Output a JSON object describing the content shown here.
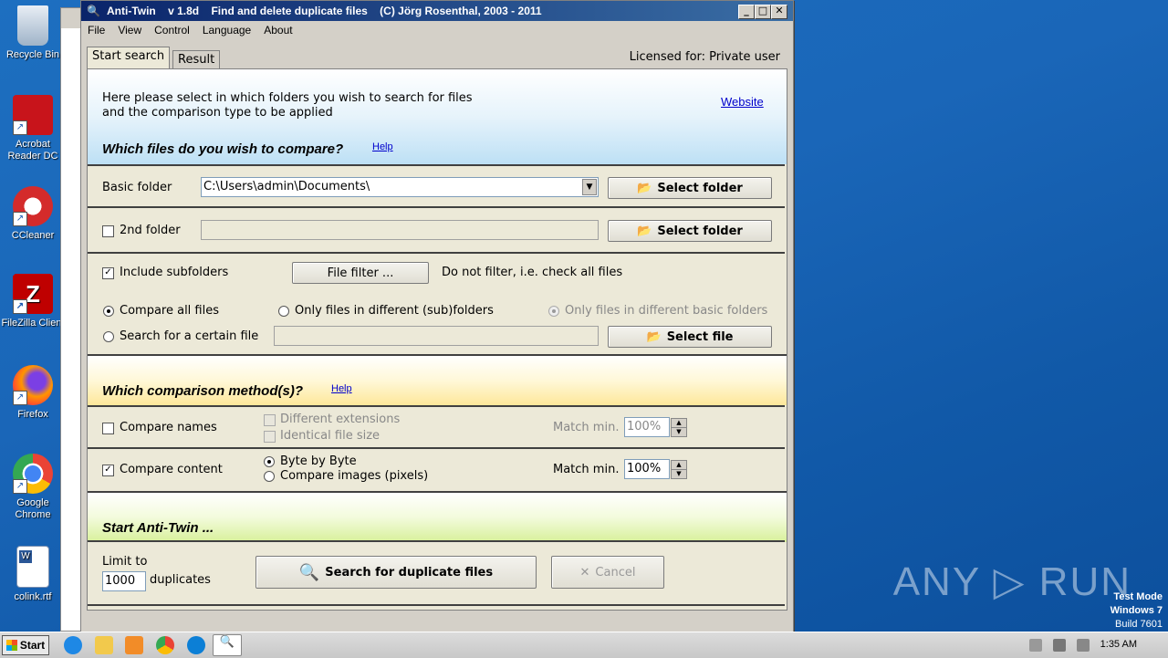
{
  "desktop": {
    "icons": [
      {
        "label": "Recycle Bin",
        "icon": "recycle-bin-icon"
      },
      {
        "label": "Acrobat Reader DC",
        "icon": "acrobat-icon"
      },
      {
        "label": "CCleaner",
        "icon": "ccleaner-icon"
      },
      {
        "label": "FileZilla Client",
        "icon": "filezilla-icon"
      },
      {
        "label": "Firefox",
        "icon": "firefox-icon"
      },
      {
        "label": "Google Chrome",
        "icon": "chrome-icon"
      },
      {
        "label": "colink.rtf",
        "icon": "word-doc-icon"
      }
    ],
    "watermark": "ANY ▷ RUN",
    "test_mode": {
      "line1": "Test Mode",
      "line2": "Windows 7",
      "line3": "Build 7601"
    }
  },
  "window": {
    "title": "Anti-Twin    v 1.8d    Find and delete duplicate files    (C) Jörg Rosenthal, 2003 - 2011",
    "menu": [
      "File",
      "View",
      "Control",
      "Language",
      "About"
    ],
    "tabs": [
      "Start search",
      "Result"
    ],
    "licensed": "Licensed for: Private user"
  },
  "intro": {
    "line1": "Here please select in which folders you wish to search for files",
    "line2": "and the comparison type to be applied",
    "website": "Website"
  },
  "files_section": {
    "title": "Which files do you wish to compare?",
    "help": "Help",
    "basic_folder_label": "Basic folder",
    "basic_folder_value": "C:\\Users\\admin\\Documents\\",
    "select_folder": "Select folder",
    "second_folder_label": "2nd folder",
    "include_subfolders": "Include subfolders",
    "file_filter": "File filter ...",
    "filter_status": "Do not filter, i.e. check all files",
    "compare_all": "Compare all files",
    "only_diff_sub": "Only files in different (sub)folders",
    "only_diff_basic": "Only files in different basic folders",
    "search_certain": "Search for a certain file",
    "select_file": "Select file"
  },
  "method_section": {
    "title": "Which comparison method(s)?",
    "help": "Help",
    "compare_names": "Compare names",
    "diff_ext": "Different extensions",
    "identical_size": "Identical file size",
    "match_min": "Match min.",
    "names_match_value": "100%",
    "compare_content": "Compare content",
    "byte_by_byte": "Byte by Byte",
    "compare_images": "Compare images (pixels)",
    "content_match_value": "100%"
  },
  "start_section": {
    "title": "Start Anti-Twin ...",
    "limit_to": "Limit to",
    "limit_value": "1000",
    "duplicates": "duplicates",
    "search_button": "Search for duplicate files",
    "cancel_button": "Cancel"
  },
  "taskbar": {
    "start": "Start",
    "clock": "1:35 AM"
  }
}
